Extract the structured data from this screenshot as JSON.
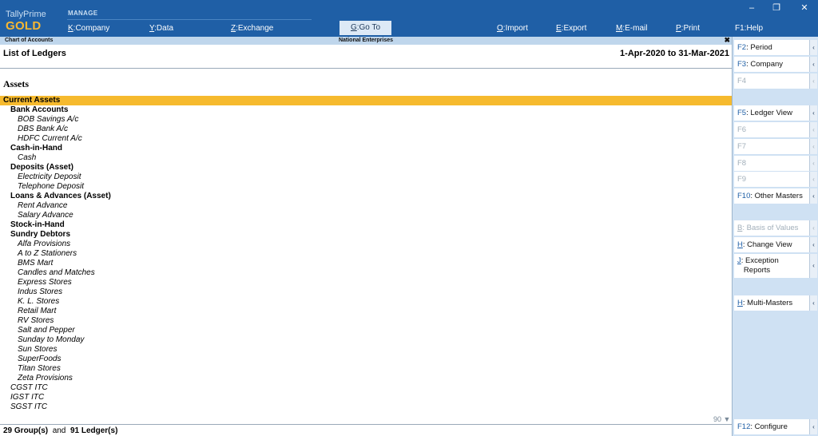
{
  "brand": {
    "product": "TallyPrime",
    "edition": "GOLD"
  },
  "topbar": {
    "section_label": "MANAGE",
    "menu": [
      {
        "key": "K",
        "label": "Company"
      },
      {
        "key": "Y",
        "label": "Data"
      },
      {
        "key": "Z",
        "label": "Exchange"
      },
      {
        "key": "G",
        "label": "Go To"
      },
      {
        "key": "O",
        "label": "Import"
      },
      {
        "key": "E",
        "label": "Export"
      },
      {
        "key": "M",
        "label": "E-mail"
      },
      {
        "key": "P",
        "label": "Print"
      },
      {
        "key": "F1",
        "label": "Help"
      }
    ],
    "window_controls": {
      "minimize": "‒",
      "restore": "❐",
      "close": "✕"
    }
  },
  "title_strip": {
    "left": "Chart of Accounts",
    "center": "National Enterprises",
    "close": "✖"
  },
  "report": {
    "title": "List of Ledgers",
    "period": "1-Apr-2020 to 31-Mar-2021",
    "section": "Assets"
  },
  "ledger_rows": [
    {
      "text": "Current Assets",
      "level": "lvl0",
      "selected": true
    },
    {
      "text": "Bank Accounts",
      "level": "lvl1"
    },
    {
      "text": "BOB Savings A/c",
      "level": "lvl2"
    },
    {
      "text": "DBS Bank A/c",
      "level": "lvl2"
    },
    {
      "text": "HDFC Current A/c",
      "level": "lvl2"
    },
    {
      "text": "Cash-in-Hand",
      "level": "lvl1"
    },
    {
      "text": "Cash",
      "level": "lvl2"
    },
    {
      "text": "Deposits (Asset)",
      "level": "lvl1"
    },
    {
      "text": "Electricity Deposit",
      "level": "lvl2"
    },
    {
      "text": "Telephone Deposit",
      "level": "lvl2"
    },
    {
      "text": "Loans & Advances (Asset)",
      "level": "lvl1"
    },
    {
      "text": "Rent Advance",
      "level": "lvl2"
    },
    {
      "text": "Salary Advance",
      "level": "lvl2"
    },
    {
      "text": "Stock-in-Hand",
      "level": "lvl1"
    },
    {
      "text": "Sundry Debtors",
      "level": "lvl1"
    },
    {
      "text": "Alfa Provisions",
      "level": "lvl2"
    },
    {
      "text": "A to Z Stationers",
      "level": "lvl2"
    },
    {
      "text": "BMS Mart",
      "level": "lvl2"
    },
    {
      "text": "Candles and Matches",
      "level": "lvl2"
    },
    {
      "text": "Express Stores",
      "level": "lvl2"
    },
    {
      "text": "Indus Stores",
      "level": "lvl2"
    },
    {
      "text": "K. L. Stores",
      "level": "lvl2"
    },
    {
      "text": "Retail Mart",
      "level": "lvl2"
    },
    {
      "text": "RV Stores",
      "level": "lvl2"
    },
    {
      "text": "Salt and Pepper",
      "level": "lvl2"
    },
    {
      "text": "Sunday to Monday",
      "level": "lvl2"
    },
    {
      "text": "Sun Stores",
      "level": "lvl2"
    },
    {
      "text": "SuperFoods",
      "level": "lvl2"
    },
    {
      "text": "Titan Stores",
      "level": "lvl2"
    },
    {
      "text": "Zeta Provisions",
      "level": "lvl2"
    },
    {
      "text": "CGST ITC",
      "level": "lvl0i"
    },
    {
      "text": "IGST ITC",
      "level": "lvl0i"
    },
    {
      "text": "SGST ITC",
      "level": "lvl0i"
    }
  ],
  "pager": {
    "count": "90",
    "arrow": "▼"
  },
  "footer": {
    "groups": "29 Group(s)",
    "and": "and",
    "ledgers": "91 Ledger(s)"
  },
  "right_panel": [
    {
      "key": "F2",
      "label": "Period",
      "disabled": false
    },
    {
      "key": "F3",
      "label": "Company",
      "disabled": false
    },
    {
      "key": "F4",
      "label": "",
      "disabled": true
    },
    {
      "key": "F5",
      "label": "Ledger View",
      "disabled": false
    },
    {
      "key": "F6",
      "label": "",
      "disabled": true
    },
    {
      "key": "F7",
      "label": "",
      "disabled": true
    },
    {
      "key": "F8",
      "label": "",
      "disabled": true
    },
    {
      "key": "F9",
      "label": "",
      "disabled": true
    },
    {
      "key": "F10",
      "label": "Other Masters",
      "disabled": false
    },
    {
      "key": "B",
      "label": "Basis of Values",
      "disabled": true
    },
    {
      "key": "H",
      "label": "Change View",
      "disabled": false
    },
    {
      "key": "J",
      "label": "Exception",
      "label2": "Reports",
      "disabled": false
    },
    {
      "key": "H",
      "label": "Multi-Masters",
      "disabled": false
    },
    {
      "key": "F12",
      "label": "Configure",
      "disabled": false
    }
  ],
  "colors": {
    "topbar": "#1f5fa6",
    "gold": "#f7b732",
    "selected_row": "#f6ba2e",
    "panel": "#cfe1f3"
  }
}
